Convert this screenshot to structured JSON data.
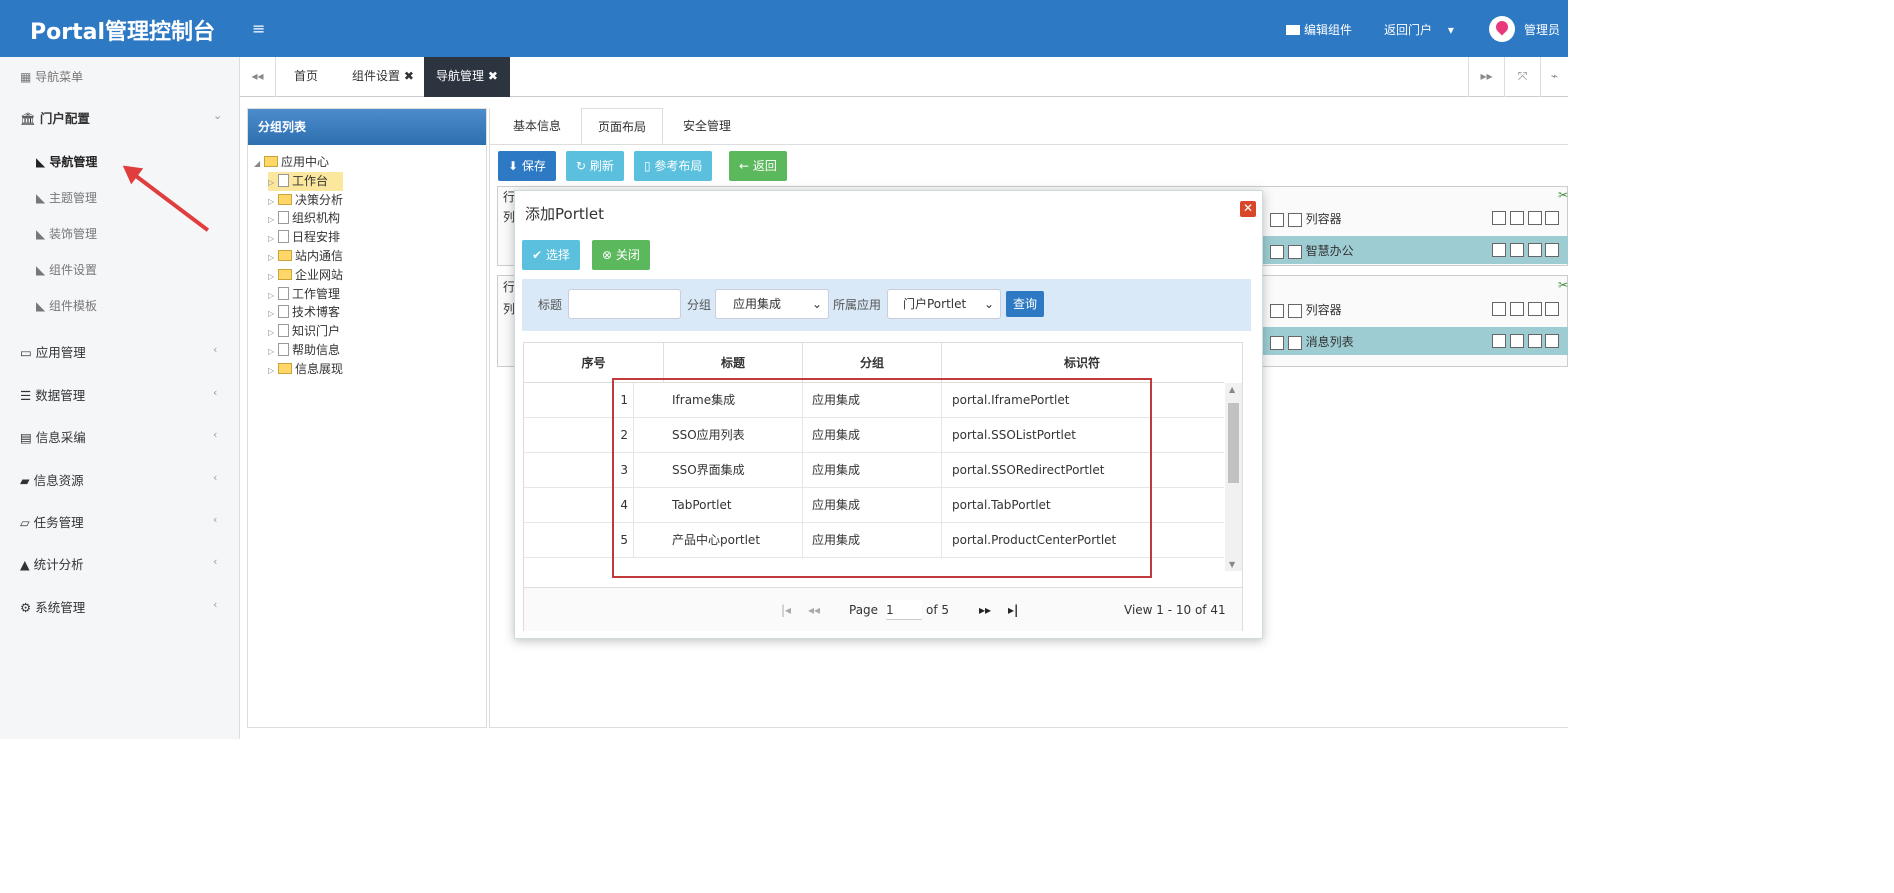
{
  "header": {
    "brand": "Portal管理控制台",
    "edit_components": "编辑组件",
    "back_portal": "返回门户",
    "user": "管理员"
  },
  "sidebar": {
    "nav_title": "导航菜单",
    "portal_config": "门户配置",
    "sub_items": [
      "导航管理",
      "主题管理",
      "装饰管理",
      "组件设置",
      "组件模板"
    ],
    "items": [
      "应用管理",
      "数据管理",
      "信息采编",
      "信息资源",
      "任务管理",
      "统计分析",
      "系统管理"
    ]
  },
  "tabs": [
    "首页",
    "组件设置",
    "导航管理"
  ],
  "group_panel": {
    "title": "分组列表",
    "root": "应用中心",
    "nodes": [
      "工作台",
      "决策分析",
      "组织机构",
      "日程安排",
      "站内通信",
      "企业网站",
      "工作管理",
      "技术博客",
      "知识门户",
      "帮助信息",
      "信息展现"
    ]
  },
  "main_tabs": [
    "基本信息",
    "页面布局",
    "安全管理"
  ],
  "toolbar": {
    "save": "保存",
    "refresh": "刷新",
    "ref_layout": "参考布局",
    "back": "返回"
  },
  "layout_bg": {
    "row_label": "行",
    "col_label": "列",
    "container": "列容器",
    "portlet1": "智慧办公",
    "portlet2": "消息列表"
  },
  "dialog": {
    "title": "添加Portlet",
    "select_btn": "选择",
    "close_btn": "关闭",
    "label_title": "标题",
    "label_group": "分组",
    "group_value": "应用集成",
    "label_app": "所属应用",
    "app_value": "门户Portlet",
    "query_btn": "查询",
    "columns": [
      "序号",
      "标题",
      "分组",
      "标识符"
    ],
    "rows": [
      {
        "no": "1",
        "title": "Iframe集成",
        "group": "应用集成",
        "id": "portal.IframePortlet"
      },
      {
        "no": "2",
        "title": "SSO应用列表",
        "group": "应用集成",
        "id": "portal.SSOListPortlet"
      },
      {
        "no": "3",
        "title": "SSO界面集成",
        "group": "应用集成",
        "id": "portal.SSORedirectPortlet"
      },
      {
        "no": "4",
        "title": "TabPortlet",
        "group": "应用集成",
        "id": "portal.TabPortlet"
      },
      {
        "no": "5",
        "title": "产品中心portlet",
        "group": "应用集成",
        "id": "portal.ProductCenterPortlet"
      }
    ],
    "pager": {
      "page_label": "Page",
      "page_value": "1",
      "of_label": "of 5",
      "view_text": "View 1 - 10 of 41"
    }
  },
  "colors": {
    "header": "#2e79c4",
    "save": "#2e79c4",
    "refresh": "#5bc0de",
    "back": "#5cb85c",
    "highlight": "#c0393b"
  }
}
